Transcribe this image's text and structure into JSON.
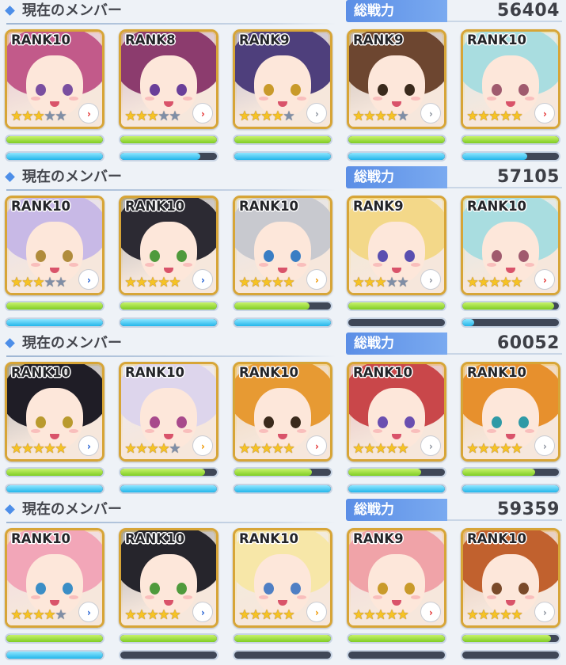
{
  "teams": [
    {
      "title": "現在のメンバー",
      "power_label": "総戦力",
      "power": "56404",
      "members": [
        {
          "rank": "RANK10",
          "stars": 3,
          "arrow": "red",
          "hp": 1.0,
          "tp": 1.0,
          "hair": "#c25a8a",
          "eye": "#7a4fa0"
        },
        {
          "rank": "RANK8",
          "stars": 3,
          "arrow": "red",
          "hp": 1.0,
          "tp": 0.83,
          "hair": "#8c3c6e",
          "eye": "#6a3f99"
        },
        {
          "rank": "RANK9",
          "stars": 4,
          "arrow": "silver",
          "hp": 1.0,
          "tp": 1.0,
          "hair": "#4e3f7c",
          "eye": "#c99a2a"
        },
        {
          "rank": "RANK9",
          "stars": 4,
          "arrow": "silver",
          "hp": 1.0,
          "tp": 1.0,
          "hair": "#6d4630",
          "eye": "#3a2a1c"
        },
        {
          "rank": "RANK10",
          "stars": 5,
          "arrow": "red",
          "hp": 1.0,
          "tp": 0.67,
          "hair": "#a9dde0",
          "eye": "#a05a6e"
        }
      ]
    },
    {
      "title": "現在のメンバー",
      "power_label": "総戦力",
      "power": "57105",
      "members": [
        {
          "rank": "RANK10",
          "stars": 3,
          "arrow": "blue",
          "hp": 1.0,
          "tp": 1.0,
          "hair": "#c8b9e6",
          "eye": "#b08c3c"
        },
        {
          "rank": "RANK10",
          "stars": 5,
          "arrow": "blue",
          "hp": 1.0,
          "tp": 1.0,
          "hair": "#2c2a33",
          "eye": "#4f9a3c"
        },
        {
          "rank": "RANK10",
          "stars": 5,
          "arrow": "orange",
          "hp": 0.78,
          "tp": 1.0,
          "hair": "#c8c9cf",
          "eye": "#3a7ec4"
        },
        {
          "rank": "RANK9",
          "stars": 3,
          "arrow": "silver",
          "hp": 1.0,
          "tp": 0.0,
          "hair": "#f3d889",
          "eye": "#5a4fb0"
        },
        {
          "rank": "RANK10",
          "stars": 5,
          "arrow": "red",
          "hp": 0.95,
          "tp": 0.12,
          "hair": "#a9dde0",
          "eye": "#a05a6e"
        }
      ]
    },
    {
      "title": "現在のメンバー",
      "power_label": "総戦力",
      "power": "60052",
      "members": [
        {
          "rank": "RANK10",
          "stars": 5,
          "arrow": "blue",
          "hp": 1.0,
          "tp": 1.0,
          "hair": "#1f1d26",
          "eye": "#b99a2e"
        },
        {
          "rank": "RANK10",
          "stars": 4,
          "arrow": "orange",
          "hp": 0.88,
          "tp": 1.0,
          "hair": "#ddd5ec",
          "eye": "#a84a8c"
        },
        {
          "rank": "RANK10",
          "stars": 5,
          "arrow": "red",
          "hp": 0.8,
          "tp": 1.0,
          "hair": "#e79a33",
          "eye": "#3a2a1c"
        },
        {
          "rank": "RANK10",
          "stars": 5,
          "arrow": "silver",
          "hp": 0.75,
          "tp": 1.0,
          "hair": "#c9474a",
          "eye": "#6a4fb0"
        },
        {
          "rank": "RANK10",
          "stars": 5,
          "arrow": "silver",
          "hp": 0.75,
          "tp": 1.0,
          "hair": "#e7902d",
          "eye": "#2f9aa6"
        }
      ]
    },
    {
      "title": "現在のメンバー",
      "power_label": "総戦力",
      "power": "59359",
      "members": [
        {
          "rank": "RANK10",
          "stars": 4,
          "arrow": "blue",
          "hp": 1.0,
          "tp": 1.0,
          "hair": "#f2a6b8",
          "eye": "#3b8ec6"
        },
        {
          "rank": "RANK10",
          "stars": 5,
          "arrow": "blue",
          "hp": 1.0,
          "tp": 0.0,
          "hair": "#26252c",
          "eye": "#4f9a3c"
        },
        {
          "rank": "RANK10",
          "stars": 5,
          "arrow": "orange",
          "hp": 1.0,
          "tp": 0.0,
          "hair": "#f7e7a8",
          "eye": "#4f7fc4"
        },
        {
          "rank": "RANK9",
          "stars": 5,
          "arrow": "red",
          "hp": 1.0,
          "tp": 0.0,
          "hair": "#f0a3a8",
          "eye": "#c99a2a"
        },
        {
          "rank": "RANK10",
          "stars": 5,
          "arrow": "silver",
          "hp": 0.92,
          "tp": 0.0,
          "hair": "#c1612e",
          "eye": "#7a4a2a"
        }
      ]
    }
  ],
  "colors": {
    "accent": "#5b8ee6",
    "hp_bar": "#7fcd24",
    "tp_bar": "#23b6ea",
    "frame_gold": "#d7a537",
    "star_on": "#f6c324",
    "star_off": "#7f8ea6"
  },
  "icons": {
    "section": "diamond-icon",
    "star": "star-icon",
    "arrow": "chevron-right-icon"
  }
}
